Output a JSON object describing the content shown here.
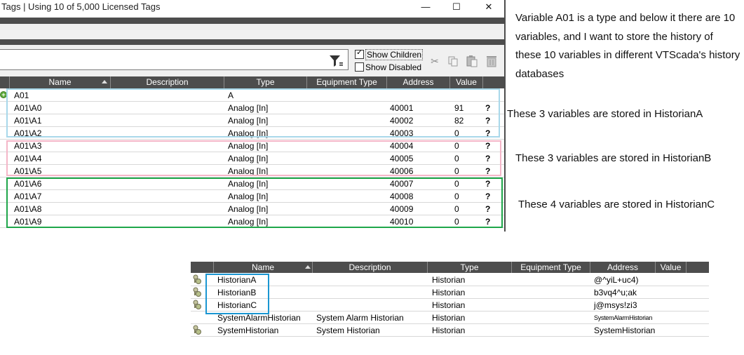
{
  "window": {
    "title": "Tags | Using 10 of 5,000 Licensed Tags",
    "minimize_glyph": "—",
    "maximize_glyph": "☐",
    "close_glyph": "✕"
  },
  "toolbar": {
    "show_children_label": "Show Children",
    "show_children_checked": true,
    "show_disabled_label": "Show Disabled",
    "show_disabled_checked": false,
    "cut_icon": "scissors-icon",
    "copy_icon": "copy-icon",
    "paste_icon": "paste-icon",
    "delete_icon": "trash-icon",
    "filter_icon": "filter-icon"
  },
  "grid": {
    "columns": [
      "Name",
      "Description",
      "Type",
      "Equipment Type",
      "Address",
      "Value"
    ],
    "rows": [
      {
        "name": "A01",
        "description": "",
        "type": "A",
        "equipment_type": "",
        "address": "",
        "value": "",
        "flag": ""
      },
      {
        "name": "A01\\A0",
        "description": "",
        "type": "Analog [In]",
        "equipment_type": "",
        "address": "40001",
        "value": "91",
        "flag": "?"
      },
      {
        "name": "A01\\A1",
        "description": "",
        "type": "Analog [In]",
        "equipment_type": "",
        "address": "40002",
        "value": "82",
        "flag": "?"
      },
      {
        "name": "A01\\A2",
        "description": "",
        "type": "Analog [In]",
        "equipment_type": "",
        "address": "40003",
        "value": "0",
        "flag": "?"
      },
      {
        "name": "A01\\A3",
        "description": "",
        "type": "Analog [In]",
        "equipment_type": "",
        "address": "40004",
        "value": "0",
        "flag": "?"
      },
      {
        "name": "A01\\A4",
        "description": "",
        "type": "Analog [In]",
        "equipment_type": "",
        "address": "40005",
        "value": "0",
        "flag": "?"
      },
      {
        "name": "A01\\A5",
        "description": "",
        "type": "Analog [In]",
        "equipment_type": "",
        "address": "40006",
        "value": "0",
        "flag": "?"
      },
      {
        "name": "A01\\A6",
        "description": "",
        "type": "Analog [In]",
        "equipment_type": "",
        "address": "40007",
        "value": "0",
        "flag": "?"
      },
      {
        "name": "A01\\A7",
        "description": "",
        "type": "Analog [In]",
        "equipment_type": "",
        "address": "40008",
        "value": "0",
        "flag": "?"
      },
      {
        "name": "A01\\A8",
        "description": "",
        "type": "Analog [In]",
        "equipment_type": "",
        "address": "40009",
        "value": "0",
        "flag": "?"
      },
      {
        "name": "A01\\A9",
        "description": "",
        "type": "Analog [In]",
        "equipment_type": "",
        "address": "40010",
        "value": "0",
        "flag": "?"
      }
    ],
    "group_colors": {
      "historian_a": "#a8d8ea",
      "historian_b": "#f4b6c8",
      "historian_c": "#1fa64a"
    }
  },
  "annotations": {
    "main_note": "Variable A01 is a type and below it there are 10 variables, and I want to store the history of these 10 variables in different VTScada's history databases",
    "note_a": "These 3 variables are stored in HistorianA",
    "note_b": "These 3 variables are stored in HistorianB",
    "note_c": "These 4 variables are stored in HistorianC"
  },
  "historian_grid": {
    "columns": [
      "Name",
      "Description",
      "Type",
      "Equipment Type",
      "Address",
      "Value"
    ],
    "rows": [
      {
        "name": "HistorianA",
        "description": "",
        "type": "Historian",
        "equipment_type": "",
        "address": "@^yiL+uc4)",
        "value": "",
        "icon": true
      },
      {
        "name": "HistorianB",
        "description": "",
        "type": "Historian",
        "equipment_type": "",
        "address": "b3vq4^u;ak",
        "value": "",
        "icon": true
      },
      {
        "name": "HistorianC",
        "description": "",
        "type": "Historian",
        "equipment_type": "",
        "address": "j@msys!zi3",
        "value": "",
        "icon": true
      },
      {
        "name": "SystemAlarmHistorian",
        "description": "System Alarm Historian",
        "type": "Historian",
        "equipment_type": "",
        "address": "SystemAlarmHistorian",
        "value": "",
        "icon": false
      },
      {
        "name": "SystemHistorian",
        "description": "System Historian",
        "type": "Historian",
        "equipment_type": "",
        "address": "SystemHistorian",
        "value": "",
        "icon": true
      }
    ],
    "highlight_color": "#1a96d2"
  }
}
